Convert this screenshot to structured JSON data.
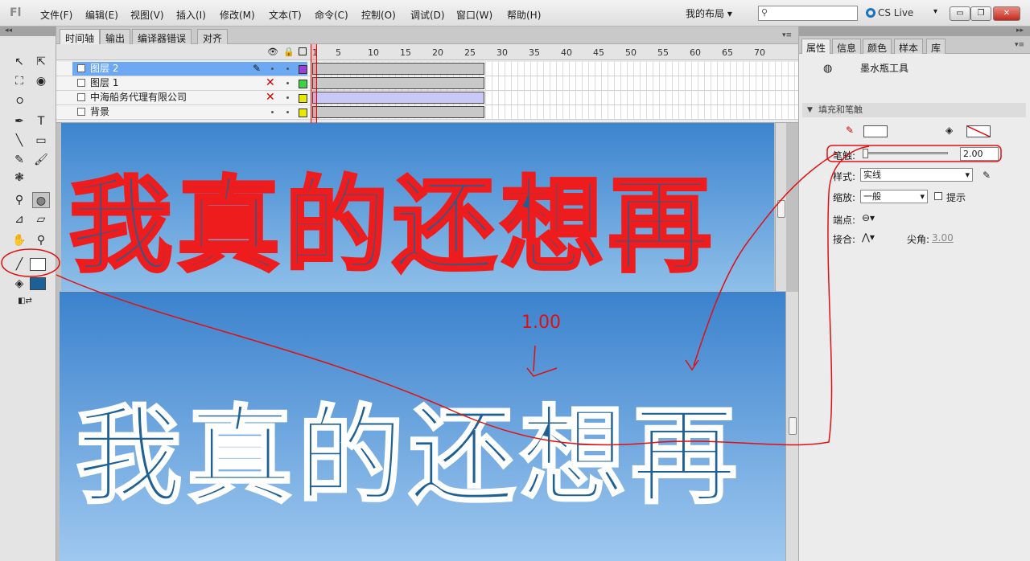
{
  "app": {
    "logo": "Fl",
    "layout_label": "我的布局",
    "layout_arrow": "▾",
    "cs_live": "CS Live",
    "cs_live_arrow": "▾"
  },
  "menus": [
    "文件(F)",
    "编辑(E)",
    "视图(V)",
    "插入(I)",
    "修改(M)",
    "文本(T)",
    "命令(C)",
    "控制(O)",
    "调试(D)",
    "窗口(W)",
    "帮助(H)"
  ],
  "search": {
    "placeholder": ""
  },
  "window_controls": [
    "▭",
    "❐",
    "✕"
  ],
  "timeline": {
    "tabs": [
      "时间轴",
      "输出",
      "编译器错误",
      "对齐"
    ],
    "frame_numbers": [
      "1",
      "5",
      "10",
      "15",
      "20",
      "25",
      "30",
      "35",
      "40",
      "45",
      "50",
      "55",
      "60",
      "65",
      "70"
    ],
    "layers": [
      {
        "name": "图层 2",
        "selected": true,
        "color": "#9b3fd4",
        "locked_x": false
      },
      {
        "name": "图层 1",
        "selected": false,
        "color": "#3ed441",
        "locked_x": true
      },
      {
        "name": "中海船务代理有限公司",
        "selected": false,
        "color": "#e8e800",
        "locked_x": true
      },
      {
        "name": "背景",
        "selected": false,
        "color": "#e8e800",
        "locked_x": false
      }
    ]
  },
  "stage": {
    "text_top": "我真的还想再",
    "text_bottom": "我真的还想再",
    "annotation_value": "1.00"
  },
  "properties": {
    "tabs": [
      "属性",
      "信息",
      "颜色",
      "样本",
      "库"
    ],
    "tool_name": "墨水瓶工具",
    "section_title": "填充和笔触",
    "stroke_label": "笔触:",
    "stroke_value": "2.00",
    "style_label": "样式:",
    "style_value": "实线",
    "scale_label": "缩放:",
    "scale_value": "一般",
    "hint_label": "提示",
    "cap_label": "端点:",
    "join_label": "接合:",
    "miter_label": "尖角:",
    "miter_value": "3.00",
    "colors": {
      "stroke": "#ffffff",
      "fill": "none"
    }
  },
  "toolbox": {
    "stroke_color": "#ffffff",
    "fill_color": "#1c6095"
  }
}
